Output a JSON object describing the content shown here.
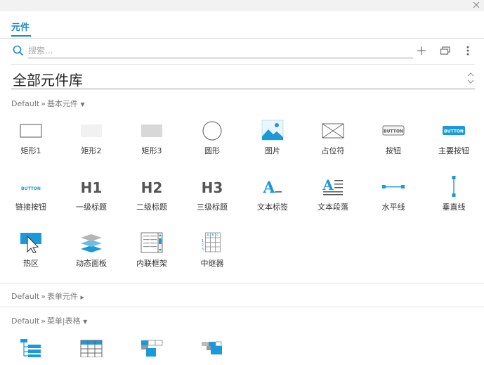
{
  "tabs": {
    "active": "元件"
  },
  "search": {
    "placeholder": "搜索...",
    "value": ""
  },
  "library": {
    "title": "全部元件库"
  },
  "sections": [
    {
      "prefix": "Default",
      "sep": "»",
      "name": "基本元件",
      "arrow": "▼"
    },
    {
      "prefix": "Default",
      "sep": "»",
      "name": "表单元件",
      "arrow": "▶"
    },
    {
      "prefix": "Default",
      "sep": "»",
      "name": "菜单|表格",
      "arrow": "▼"
    }
  ],
  "basic_items": [
    {
      "label": "矩形1",
      "icon": "rectangle-icon"
    },
    {
      "label": "矩形2",
      "icon": "rectangle-light-icon"
    },
    {
      "label": "矩形3",
      "icon": "rectangle-gray-icon"
    },
    {
      "label": "圆形",
      "icon": "circle-icon"
    },
    {
      "label": "图片",
      "icon": "image-icon"
    },
    {
      "label": "占位符",
      "icon": "placeholder-icon"
    },
    {
      "label": "按钮",
      "icon": "button-icon",
      "text": "BUTTON"
    },
    {
      "label": "主要按钮",
      "icon": "primary-button-icon",
      "text": "BUTTON"
    },
    {
      "label": "链接按钮",
      "icon": "link-button-icon",
      "text": "BUTTON"
    },
    {
      "label": "一级标题",
      "icon": "heading1-icon",
      "text": "H1"
    },
    {
      "label": "二级标题",
      "icon": "heading2-icon",
      "text": "H2"
    },
    {
      "label": "三级标题",
      "icon": "heading3-icon",
      "text": "H3"
    },
    {
      "label": "文本标签",
      "icon": "text-label-icon",
      "text": "A"
    },
    {
      "label": "文本段落",
      "icon": "text-paragraph-icon",
      "text": "A"
    },
    {
      "label": "水平线",
      "icon": "horizontal-line-icon"
    },
    {
      "label": "垂直线",
      "icon": "vertical-line-icon"
    },
    {
      "label": "热区",
      "icon": "hotspot-icon"
    },
    {
      "label": "动态面板",
      "icon": "dynamic-panel-icon"
    },
    {
      "label": "内联框架",
      "icon": "inline-frame-icon"
    },
    {
      "label": "中继器",
      "icon": "repeater-icon",
      "headers": [
        "A",
        "B",
        "C"
      ],
      "rows": [
        "1",
        "2",
        "3"
      ]
    }
  ],
  "menu_items": [
    {
      "icon": "tree-icon"
    },
    {
      "icon": "table-icon"
    },
    {
      "icon": "classic-menu-icon"
    },
    {
      "icon": "horizontal-menu-icon"
    }
  ],
  "colors": {
    "accent": "#1e88c7",
    "icon_blue": "#1a9ad9",
    "text": "#333333",
    "muted": "#777777"
  }
}
